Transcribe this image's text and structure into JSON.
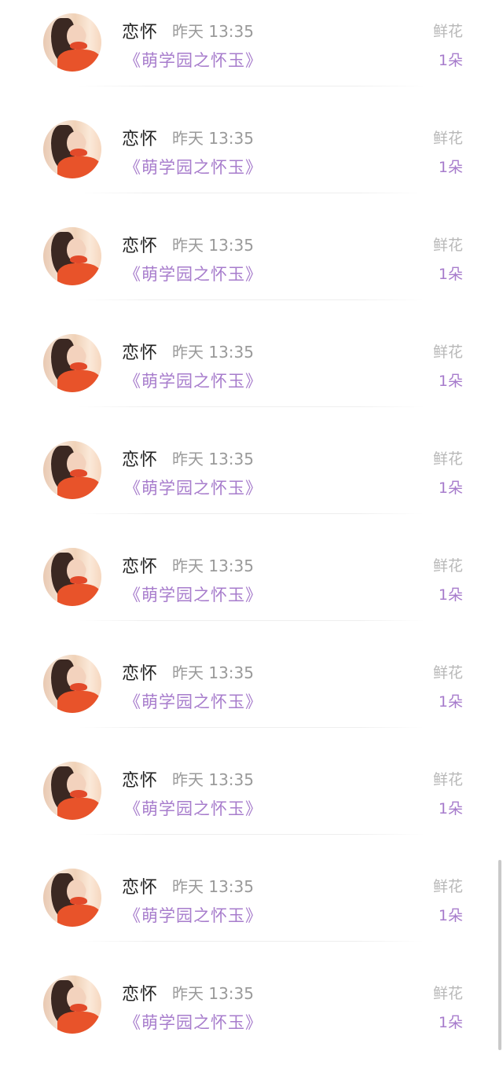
{
  "items": [
    {
      "name": "恋怀",
      "time": "昨天 13:35",
      "title": "《萌学园之怀玉》",
      "gift": "鲜花",
      "count": "1朵",
      "avatar_icon": "avatar-photo"
    },
    {
      "name": "恋怀",
      "time": "昨天 13:35",
      "title": "《萌学园之怀玉》",
      "gift": "鲜花",
      "count": "1朵",
      "avatar_icon": "avatar-photo"
    },
    {
      "name": "恋怀",
      "time": "昨天 13:35",
      "title": "《萌学园之怀玉》",
      "gift": "鲜花",
      "count": "1朵",
      "avatar_icon": "avatar-photo"
    },
    {
      "name": "恋怀",
      "time": "昨天 13:35",
      "title": "《萌学园之怀玉》",
      "gift": "鲜花",
      "count": "1朵",
      "avatar_icon": "avatar-photo"
    },
    {
      "name": "恋怀",
      "time": "昨天 13:35",
      "title": "《萌学园之怀玉》",
      "gift": "鲜花",
      "count": "1朵",
      "avatar_icon": "avatar-photo"
    },
    {
      "name": "恋怀",
      "time": "昨天 13:35",
      "title": "《萌学园之怀玉》",
      "gift": "鲜花",
      "count": "1朵",
      "avatar_icon": "avatar-photo"
    },
    {
      "name": "恋怀",
      "time": "昨天 13:35",
      "title": "《萌学园之怀玉》",
      "gift": "鲜花",
      "count": "1朵",
      "avatar_icon": "avatar-photo"
    },
    {
      "name": "恋怀",
      "time": "昨天 13:35",
      "title": "《萌学园之怀玉》",
      "gift": "鲜花",
      "count": "1朵",
      "avatar_icon": "avatar-photo"
    },
    {
      "name": "恋怀",
      "time": "昨天 13:35",
      "title": "《萌学园之怀玉》",
      "gift": "鲜花",
      "count": "1朵",
      "avatar_icon": "avatar-photo"
    },
    {
      "name": "恋怀",
      "time": "昨天 13:35",
      "title": "《萌学园之怀玉》",
      "gift": "鲜花",
      "count": "1朵",
      "avatar_icon": "avatar-photo"
    }
  ],
  "colors": {
    "accent": "#a77ccc",
    "name_text": "#222222",
    "time_text": "#9a9a9a",
    "gift_text": "#b8b8b8",
    "background": "#ffffff"
  }
}
